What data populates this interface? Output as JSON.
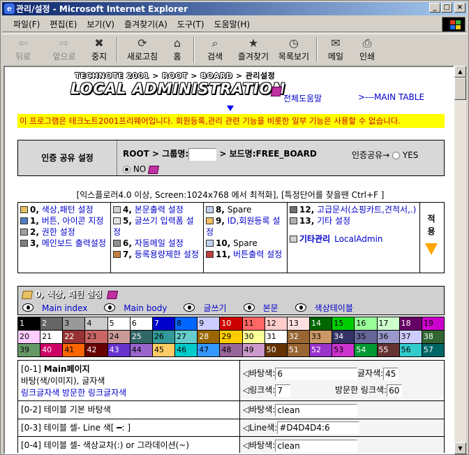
{
  "window": {
    "title": "관리/설정 - Microsoft Internet Explorer",
    "controls": [
      "_",
      "□",
      "×"
    ]
  },
  "menubar": [
    "파일(F)",
    "편집(E)",
    "보기(V)",
    "즐겨찾기(A)",
    "도구(T)",
    "도움말(H)"
  ],
  "toolbar": [
    {
      "label": "뒤로",
      "icon": "back-arrow-icon",
      "glyph": "⇦",
      "disabled": true
    },
    {
      "label": "앞으로",
      "icon": "forward-arrow-icon",
      "glyph": "⇨",
      "disabled": true
    },
    {
      "label": "중지",
      "icon": "stop-icon",
      "glyph": "✖",
      "disabled": false
    },
    {
      "label": "새로고침",
      "icon": "refresh-icon",
      "glyph": "⟳",
      "disabled": false
    },
    {
      "label": "홈",
      "icon": "home-icon",
      "glyph": "⌂",
      "disabled": false
    },
    {
      "label": "검색",
      "icon": "search-icon",
      "glyph": "⌕",
      "disabled": false
    },
    {
      "label": "즐겨찾기",
      "icon": "favorites-icon",
      "glyph": "★",
      "disabled": false
    },
    {
      "label": "목록보기",
      "icon": "history-icon",
      "glyph": "◷",
      "disabled": false
    },
    {
      "label": "메일",
      "icon": "mail-icon",
      "glyph": "✉",
      "disabled": false
    },
    {
      "label": "인쇄",
      "icon": "print-icon",
      "glyph": "⎙",
      "disabled": false
    }
  ],
  "page": {
    "breadcrumb": {
      "site": "TECHNOTE 2001",
      "sep": ">",
      "root": "ROOT",
      "board": "BOARD",
      "current": "관리설정"
    },
    "logo": "LOCAL ADMINISTRATION",
    "help_link": "전체도움말",
    "main_link": ">---MAIN TABLE",
    "notice": "이 프로그램은 테크노트2001프리웨어입니다. 회원등록,관리 관련 기능을 비롯한 일부 기능은 사용할 수 없습니다.",
    "auth": {
      "label": "인증 공유 설정",
      "root": "ROOT",
      "group_label": "그룹명:",
      "board_label": "보드명:FREE_BOARD",
      "share_label": "인증공유→",
      "yes": "YES",
      "no": "NO"
    },
    "optimize": "[익스플로러4.0 이상, Screen:1024x768 에서 최적화], [특정단어를 찾을땐 Ctrl+F ]",
    "menu_cols": [
      [
        {
          "num": "0,",
          "label": "색상,패턴 설정",
          "color": "#e8c060"
        },
        {
          "num": "1,",
          "label": "버튼, 아이콘 지정",
          "color": "#5080c0"
        },
        {
          "num": "2,",
          "label": "권한 설정",
          "color": "#a0a0a0"
        },
        {
          "num": "3,",
          "label": "메인보드 출력설정",
          "color": "#808080"
        }
      ],
      [
        {
          "num": "4,",
          "label": "본문출력 설정",
          "color": "#d0d0d0"
        },
        {
          "num": "5,",
          "label": "글쓰기 입력폼 설정",
          "color": "#e0e0e0"
        },
        {
          "num": "6,",
          "label": "자동메일 설정",
          "color": "#909090"
        },
        {
          "num": "7,",
          "label": "등록용량제한 설정",
          "color": "#c08040"
        }
      ],
      [
        {
          "num": "8,",
          "label": "Spare",
          "color": "#c0d0f0",
          "gray": true
        },
        {
          "num": "9,",
          "label": "ID,회원등록 설정",
          "color": "#f0c060"
        },
        {
          "num": "10,",
          "label": "Spare",
          "color": "#c0d0f0",
          "gray": true
        },
        {
          "num": "11,",
          "label": "버튼출력 설정",
          "color": "#c04040"
        }
      ],
      [
        {
          "num": "12,",
          "label": "고급문서(쇼핑카트,견적서,.)",
          "color": "#707070"
        },
        {
          "num": "13,",
          "label": "기타 설정",
          "color": "#b0b0b0"
        },
        {
          "num": "",
          "label": "기타관리",
          "extra": "LocalAdmin",
          "color": "#d0d0d0"
        }
      ]
    ],
    "apply_label": "적용",
    "section": {
      "title": "0, 색상, 패턴 설정",
      "links": [
        "Main index",
        "Main body",
        "글쓰기",
        "본문",
        "색상테이블"
      ]
    },
    "palette": [
      {
        "n": "1",
        "c": "#000000"
      },
      {
        "n": "2",
        "c": "#666666"
      },
      {
        "n": "3",
        "c": "#999999"
      },
      {
        "n": "4",
        "c": "#cccccc"
      },
      {
        "n": "5",
        "c": "#ffffff"
      },
      {
        "n": "6",
        "c": "#ffffff"
      },
      {
        "n": "7",
        "c": "#0000cc"
      },
      {
        "n": "8",
        "c": "#0066ff"
      },
      {
        "n": "9",
        "c": "#ccccff"
      },
      {
        "n": "10",
        "c": "#cc0000"
      },
      {
        "n": "11",
        "c": "#ff6666"
      },
      {
        "n": "12",
        "c": "#ffcccc"
      },
      {
        "n": "13",
        "c": "#ffe0e0"
      },
      {
        "n": "14",
        "c": "#006600"
      },
      {
        "n": "15",
        "c": "#00cc00"
      },
      {
        "n": "16",
        "c": "#99ff99"
      },
      {
        "n": "17",
        "c": "#ccffcc"
      },
      {
        "n": "18",
        "c": "#660066"
      },
      {
        "n": "19",
        "c": "#cc00cc"
      },
      {
        "n": "20",
        "c": "#ffccff"
      },
      {
        "n": "21",
        "c": "#ffffff"
      },
      {
        "n": "22",
        "c": "#993333"
      },
      {
        "n": "23",
        "c": "#cc6666"
      },
      {
        "n": "24",
        "c": "#cc9999"
      },
      {
        "n": "25",
        "c": "#336666"
      },
      {
        "n": "26",
        "c": "#339999"
      },
      {
        "n": "27",
        "c": "#66cccc"
      },
      {
        "n": "28",
        "c": "#996600"
      },
      {
        "n": "29",
        "c": "#ffcc00"
      },
      {
        "n": "30",
        "c": "#ffff99"
      },
      {
        "n": "31",
        "c": "#ffffff"
      },
      {
        "n": "32",
        "c": "#996633"
      },
      {
        "n": "33",
        "c": "#cc9966"
      },
      {
        "n": "34",
        "c": "#333366"
      },
      {
        "n": "35",
        "c": "#666699"
      },
      {
        "n": "36",
        "c": "#9999cc"
      },
      {
        "n": "37",
        "c": "#ccccff"
      },
      {
        "n": "38",
        "c": "#336633"
      },
      {
        "n": "39",
        "c": "#669966"
      },
      {
        "n": "40",
        "c": "#cc0066"
      },
      {
        "n": "41",
        "c": "#ff6600"
      },
      {
        "n": "42",
        "c": "#660000"
      },
      {
        "n": "43",
        "c": "#6633cc"
      },
      {
        "n": "44",
        "c": "#9966cc"
      },
      {
        "n": "45",
        "c": "#ffcc66"
      },
      {
        "n": "46",
        "c": "#00cccc"
      },
      {
        "n": "47",
        "c": "#3399ff"
      },
      {
        "n": "48",
        "c": "#996699"
      },
      {
        "n": "49",
        "c": "#cc99cc"
      },
      {
        "n": "50",
        "c": "#663300"
      },
      {
        "n": "51",
        "c": "#996633"
      },
      {
        "n": "52",
        "c": "#9933cc"
      },
      {
        "n": "53",
        "c": "#cc33cc"
      },
      {
        "n": "54",
        "c": "#009933"
      },
      {
        "n": "55",
        "c": "#663333"
      },
      {
        "n": "56",
        "c": "#33cccc"
      },
      {
        "n": "57",
        "c": "#006666"
      }
    ],
    "settings": [
      {
        "id": "[0-1]",
        "title": "Main페이지",
        "lines": [
          "바탕(색/이미지), 글자색",
          "링크글자색  방문한 링크글자색"
        ],
        "fields": [
          {
            "label": "◁바탕색:",
            "value": "6"
          },
          {
            "label": "글자색:",
            "value": "45"
          },
          {
            "label": "◁링크색:",
            "value": "7"
          },
          {
            "label": "방문한 링크색:",
            "value": "60"
          }
        ]
      },
      {
        "id": "[0-2]",
        "title": "테이블 기본 바탕색",
        "fields": [
          {
            "label": "◁바탕색:",
            "value": "clean"
          }
        ]
      },
      {
        "id": "[0-3]",
        "title": "테이블 셀- Line 색[ ━:  ]",
        "fields": [
          {
            "label": "◁Line색:",
            "value": "#D4D4D4:6"
          }
        ]
      },
      {
        "id": "[0-4]",
        "title": "테이블 셀- 색상교차(:) or 그라데이션(~)",
        "fields": [
          {
            "label": "◁바탕색:",
            "value": "clean"
          }
        ]
      }
    ]
  }
}
